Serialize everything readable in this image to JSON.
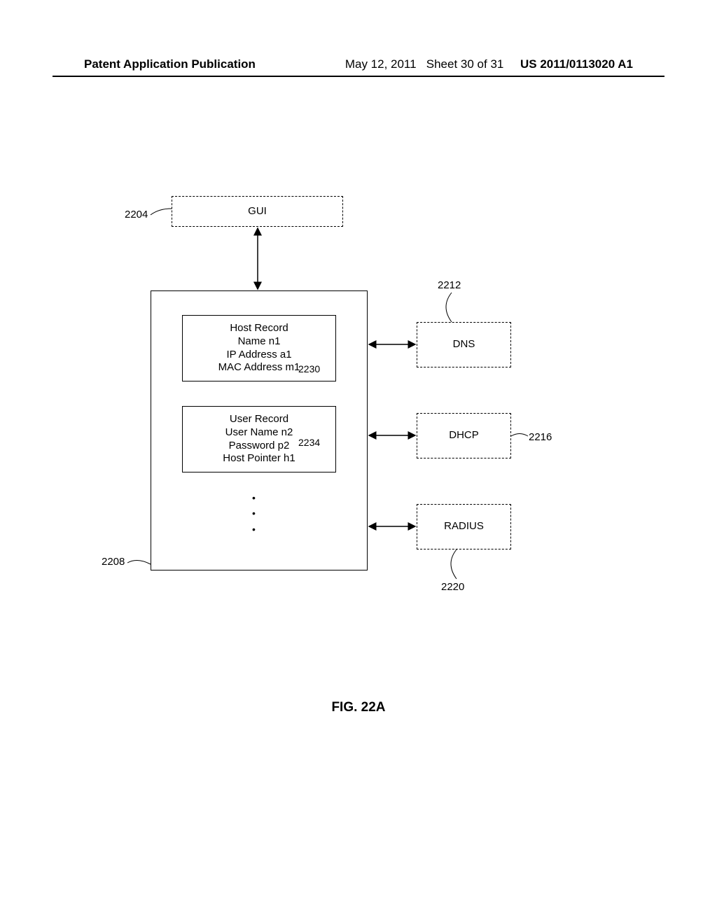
{
  "header": {
    "left": "Patent Application Publication",
    "date": "May 12, 2011",
    "sheet": "Sheet 30 of 31",
    "pubnum": "US 2011/0113020 A1"
  },
  "gui": {
    "label": "GUI",
    "ref": "2204"
  },
  "database": {
    "ref": "2208"
  },
  "host_record": {
    "title": "Host Record",
    "line2": "Name n1",
    "line3": "IP Address a1",
    "line4": "MAC Address m1",
    "ref": "2230"
  },
  "user_record": {
    "title": "User Record",
    "line2": "User Name n2",
    "line3": "Password p2",
    "line4": "Host Pointer h1",
    "ref": "2234"
  },
  "dns": {
    "label": "DNS",
    "ref": "2212"
  },
  "dhcp": {
    "label": "DHCP",
    "ref": "2216"
  },
  "radius": {
    "label": "RADIUS",
    "ref": "2220"
  },
  "figure": {
    "caption": "FIG. 22A"
  }
}
